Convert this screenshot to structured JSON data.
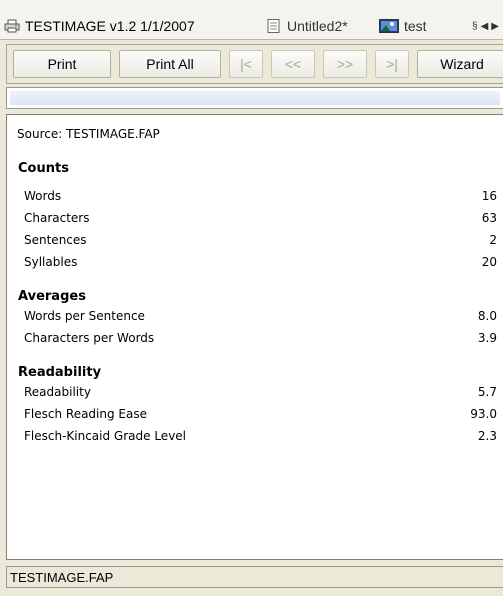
{
  "tabs": [
    {
      "label": "TESTIMAGE v1.2 1/1/2007",
      "icon": "printer-icon"
    },
    {
      "label": "Untitled2*",
      "icon": "document-icon"
    },
    {
      "label": "test",
      "icon": "image-icon"
    }
  ],
  "toolbar": {
    "print": "Print",
    "print_all": "Print All",
    "first": "|<",
    "prev": "<<",
    "next": ">>",
    "last": ">|",
    "wizard": "Wizard"
  },
  "report": {
    "source": "Source: TESTIMAGE.FAP",
    "counts": {
      "heading": "Counts",
      "rows": [
        {
          "label": "Words",
          "value": "16"
        },
        {
          "label": "Characters",
          "value": "63"
        },
        {
          "label": "Sentences",
          "value": "2"
        },
        {
          "label": "Syllables",
          "value": "20"
        }
      ]
    },
    "averages": {
      "heading": "Averages",
      "rows": [
        {
          "label": "Words per Sentence",
          "value": "8.0"
        },
        {
          "label": "Characters per Words",
          "value": "3.9"
        }
      ]
    },
    "readability": {
      "heading": "Readability",
      "rows": [
        {
          "label": "Readability",
          "value": "5.7"
        },
        {
          "label": "Flesch Reading Ease",
          "value": "93.0"
        },
        {
          "label": "Flesch-Kincaid Grade Level",
          "value": "2.3"
        }
      ]
    }
  },
  "status": "TESTIMAGE.FAP"
}
